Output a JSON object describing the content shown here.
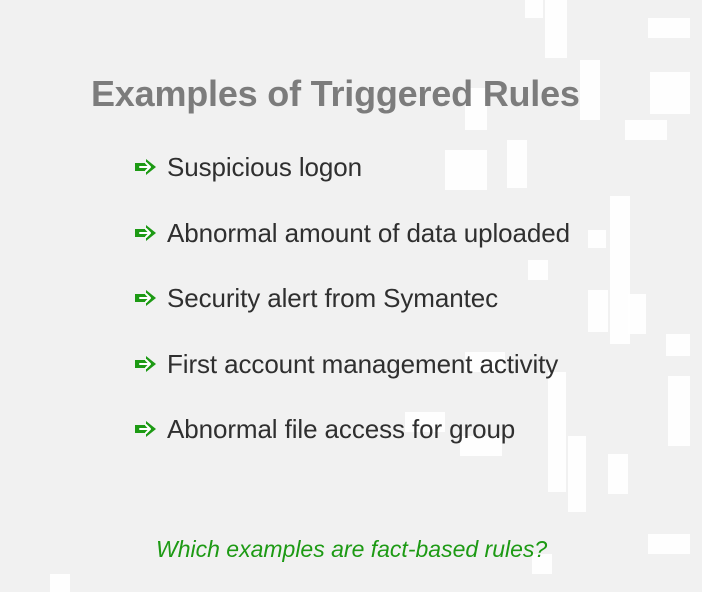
{
  "slide": {
    "title": "Examples of Triggered Rules",
    "bullet_icon": "green-arrow-icon",
    "bullets": [
      "Suspicious logon",
      "Abnormal amount of data uploaded",
      "Security alert from Symantec",
      "First account management activity",
      "Abnormal file access for group"
    ],
    "question": "Which examples are fact-based rules?"
  },
  "colors": {
    "background": "#f1f1f1",
    "title": "#7c7c7c",
    "bullet_text": "#2f2f2f",
    "accent_green": "#1d9a14",
    "decor_white": "#ffffff"
  }
}
